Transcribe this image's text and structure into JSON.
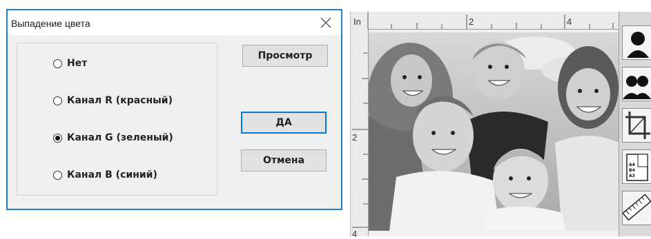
{
  "dialog": {
    "title": "Выпадение цвета",
    "options": [
      {
        "label": "Нет",
        "checked": false
      },
      {
        "label": "Канал R (красный)",
        "checked": false
      },
      {
        "label": "Канал G (зеленый)",
        "checked": true
      },
      {
        "label": "Канал B (синий)",
        "checked": false
      }
    ],
    "preview_label": "Просмотр",
    "ok_label": "ДА",
    "cancel_label": "Отмена"
  },
  "scan": {
    "ruler_unit": "In",
    "ruler_top": [
      "2",
      "4"
    ],
    "ruler_left": [
      "2",
      "4"
    ]
  },
  "toolbar": {
    "tools": [
      "portrait-icon",
      "group-portrait-icon",
      "crop-icon",
      "paper-size-icon",
      "ruler-icon"
    ],
    "paper_sizes": [
      "A4",
      "B4",
      "A3"
    ]
  },
  "colors": {
    "accent": "#0078d7",
    "dialog_border": "#1c7fd1",
    "dialog_bg": "#f0f0f0"
  }
}
